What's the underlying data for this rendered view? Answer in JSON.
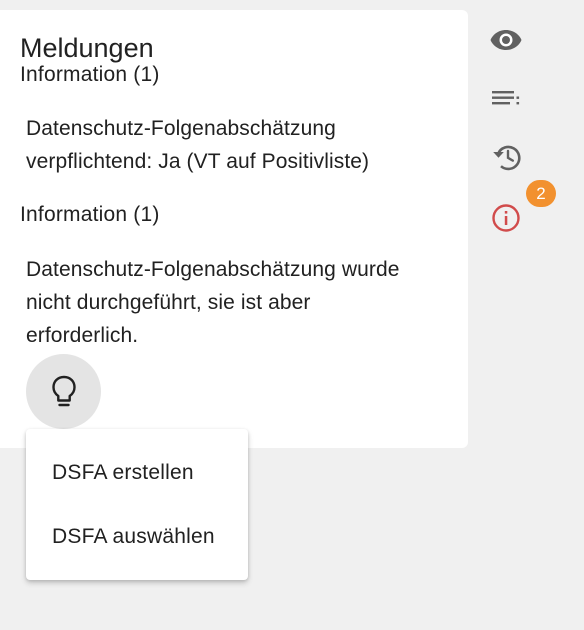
{
  "panel": {
    "title": "Meldungen",
    "messages": [
      {
        "heading": "Information (1)",
        "lines": [
          "Datenschutz-Folgenabschätzung",
          "verpflichtend: Ja (VT auf Positivliste)"
        ]
      },
      {
        "heading": "Information (1)",
        "lines": [
          "Datenschutz-Folgenabschätzung wurde",
          "nicht durchgeführt, sie ist aber",
          "erforderlich."
        ]
      }
    ]
  },
  "action_button": {
    "icon": "lightbulb-icon"
  },
  "menu": {
    "items": [
      {
        "label": "DSFA erstellen"
      },
      {
        "label": "DSFA auswählen"
      }
    ]
  },
  "sidebar": {
    "icons": [
      "eye-icon",
      "list-icon",
      "history-icon",
      "info-icon"
    ],
    "notification_count": "2",
    "colors": {
      "icon": "#616161",
      "info": "#d14b4b",
      "badge": "#f2912f"
    }
  }
}
